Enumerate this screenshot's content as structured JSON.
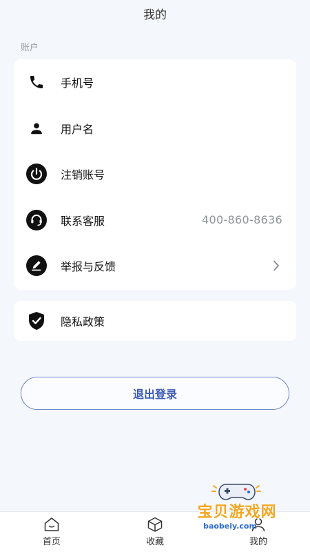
{
  "header": {
    "title": "我的"
  },
  "account": {
    "section_label": "账户",
    "items": [
      {
        "label": "手机号",
        "icon": "phone-icon"
      },
      {
        "label": "用户名",
        "icon": "user-icon"
      },
      {
        "label": "注销账号",
        "icon": "power-icon"
      },
      {
        "label": "联系客服",
        "icon": "headset-icon",
        "value": "400-860-8636"
      },
      {
        "label": "举报与反馈",
        "icon": "pen-icon",
        "chevron": "chevron-right-icon"
      }
    ]
  },
  "privacy": {
    "label": "隐私政策",
    "icon": "shield-check-icon"
  },
  "logout": {
    "label": "退出登录"
  },
  "tabbar": {
    "items": [
      {
        "label": "首页",
        "icon": "home-icon"
      },
      {
        "label": "收藏",
        "icon": "cube-icon"
      },
      {
        "label": "我的",
        "icon": "user-tab-icon"
      }
    ]
  },
  "watermark": {
    "text": "宝贝游戏网",
    "url": "baobeiy.com"
  },
  "colors": {
    "accent": "#3f5bb5",
    "background": "#f4f7fb",
    "watermark": "#f5a623"
  }
}
